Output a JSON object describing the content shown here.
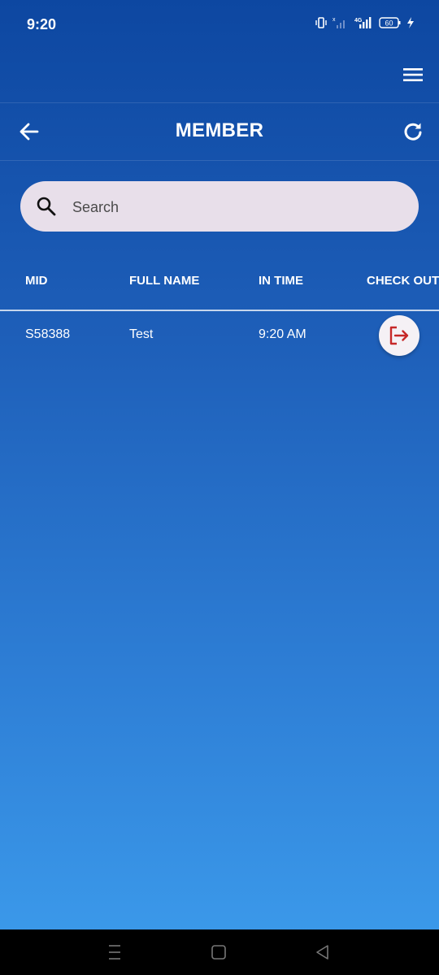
{
  "status_bar": {
    "time": "9:20",
    "network_label": "4G",
    "battery": "60"
  },
  "header": {
    "title": "MEMBER"
  },
  "search": {
    "placeholder": "Search",
    "value": ""
  },
  "table": {
    "columns": [
      "MID",
      "FULL NAME",
      "IN TIME",
      "CHECK OUT"
    ],
    "rows": [
      {
        "mid": "S58388",
        "full_name": "Test",
        "in_time": "9:20 AM"
      }
    ]
  },
  "icons": {
    "menu": "hamburger-menu-icon",
    "back": "arrow-left-icon",
    "refresh": "refresh-icon",
    "search": "search-icon",
    "checkout": "logout-icon"
  },
  "colors": {
    "background_top": "#0d47a1",
    "background_bottom": "#3d9ded",
    "search_background": "#e8dfea",
    "checkout_icon": "#c62828"
  }
}
